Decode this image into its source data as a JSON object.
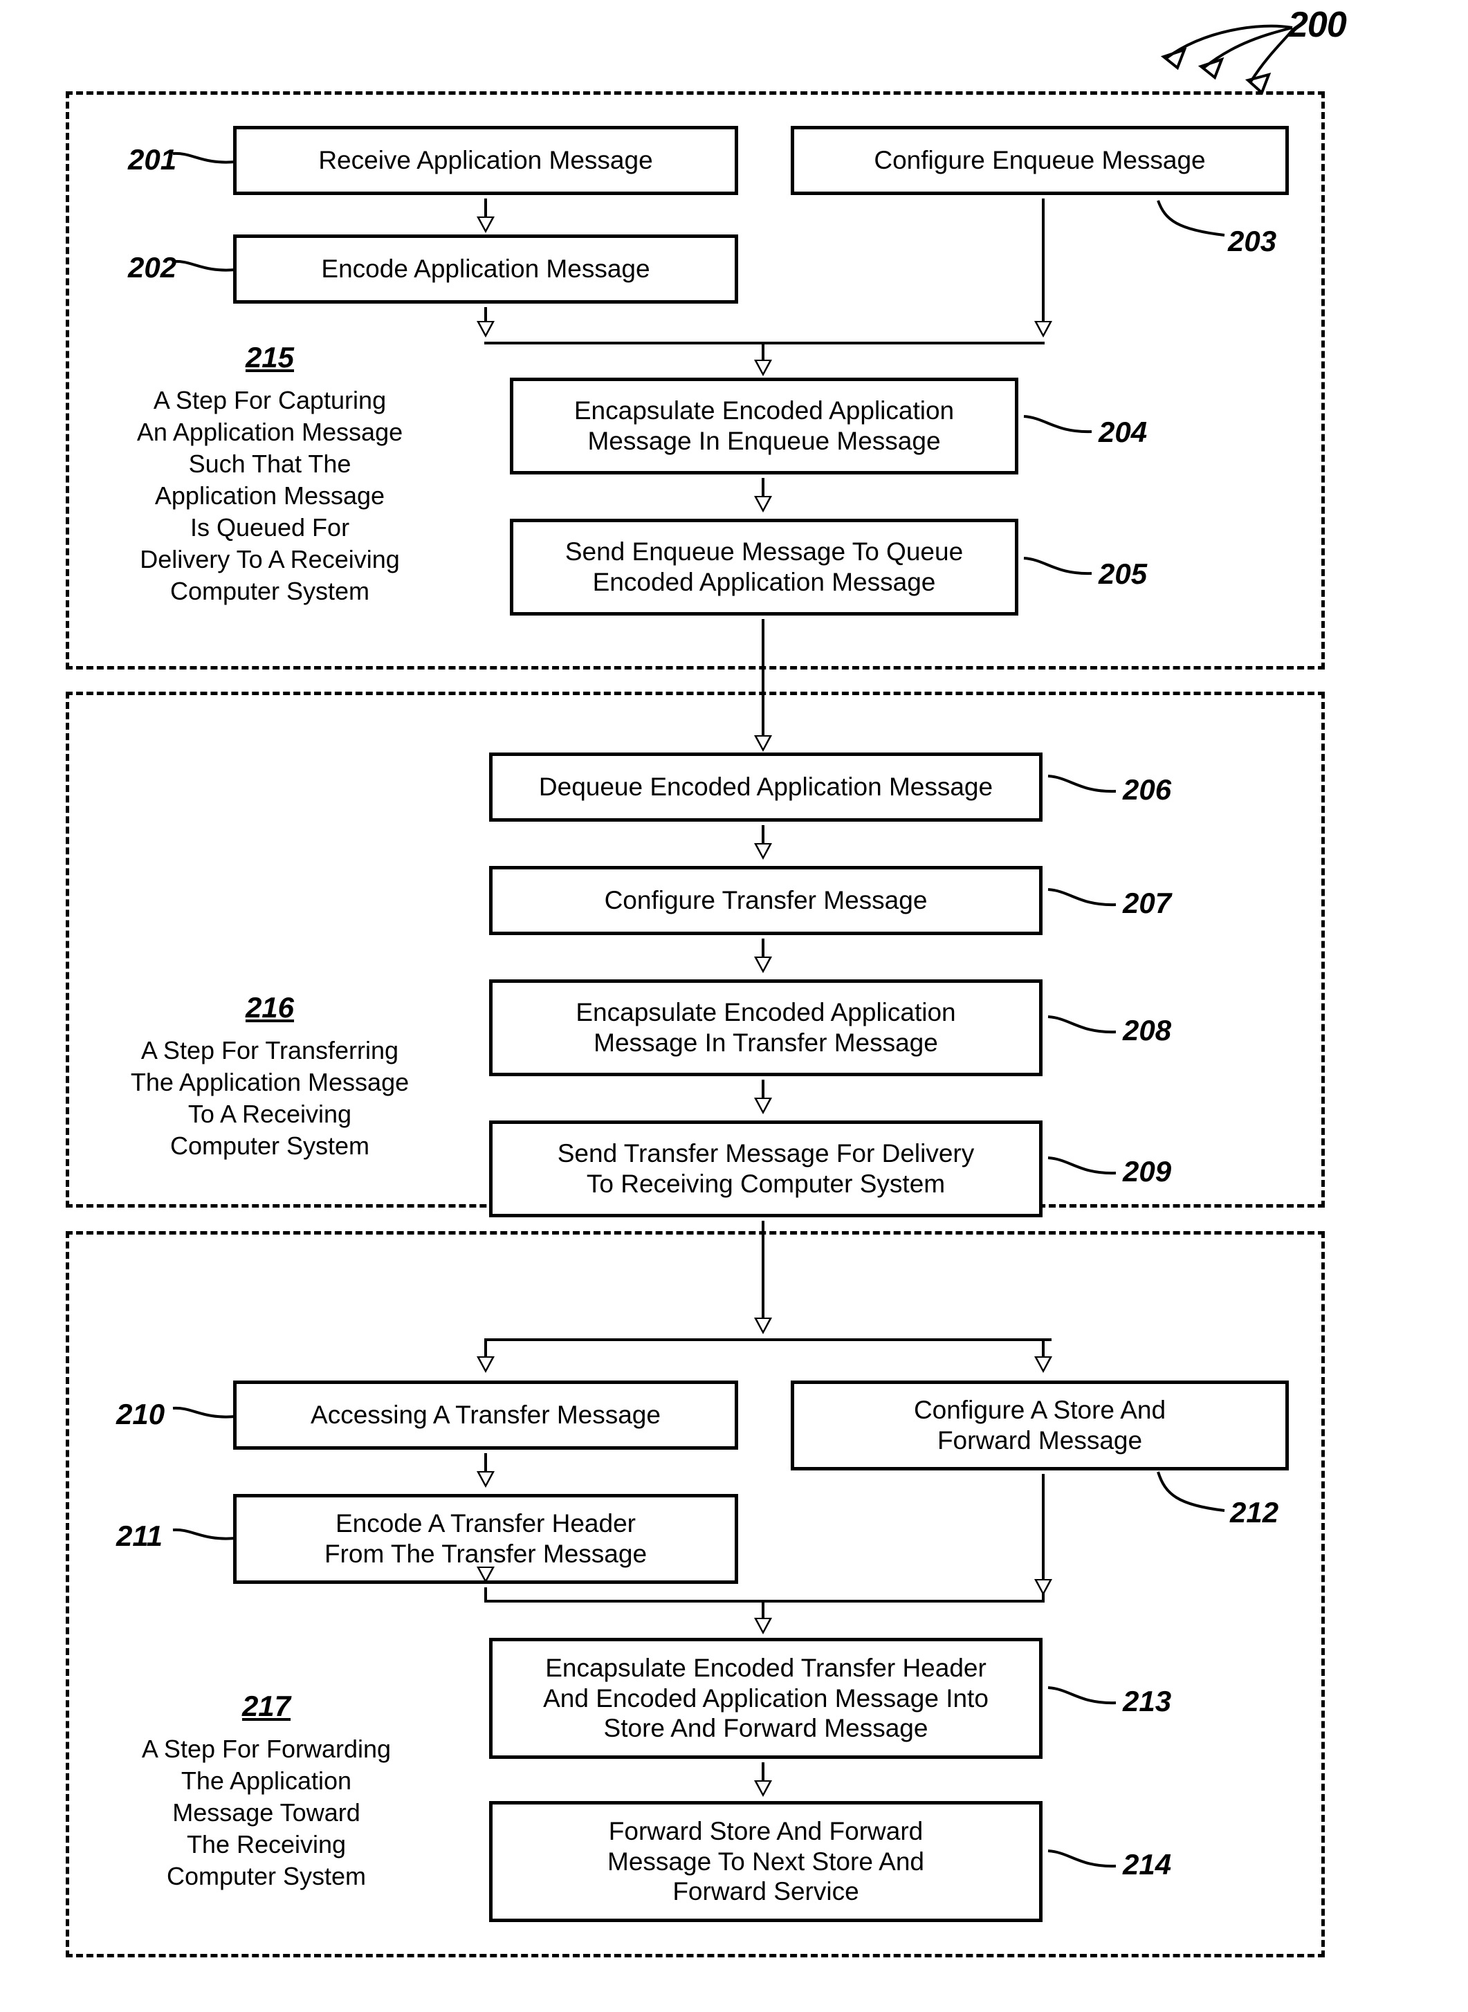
{
  "figure": {
    "number": "200",
    "pointer_icon": "curved-arrows-icon"
  },
  "sections": [
    {
      "id": "section-215",
      "step_number": "215",
      "step_text": "A Step For Capturing An Application Message Such That The Application Message Is Queued For Delivery To A Receiving Computer System",
      "step_lines": [
        "A Step For Capturing",
        "An Application Message",
        "Such That The",
        "Application Message",
        "Is Queued For",
        "Delivery To A Receiving",
        "Computer System"
      ],
      "boxes": [
        {
          "ref": "201",
          "lines": [
            "Receive Application Message"
          ]
        },
        {
          "ref": "202",
          "lines": [
            "Encode Application Message"
          ]
        },
        {
          "ref": "203",
          "lines": [
            "Configure Enqueue Message"
          ]
        },
        {
          "ref": "204",
          "lines": [
            "Encapsulate Encoded Application",
            "Message In Enqueue Message"
          ]
        },
        {
          "ref": "205",
          "lines": [
            "Send Enqueue Message To Queue",
            "Encoded Application Message"
          ]
        }
      ]
    },
    {
      "id": "section-216",
      "step_number": "216",
      "step_text": "A Step For Transferring The Application Message To A Receiving Computer System",
      "step_lines": [
        "A Step For Transferring",
        "The Application Message",
        "To A Receiving",
        "Computer System"
      ],
      "boxes": [
        {
          "ref": "206",
          "lines": [
            "Dequeue Encoded Application Message"
          ]
        },
        {
          "ref": "207",
          "lines": [
            "Configure Transfer Message"
          ]
        },
        {
          "ref": "208",
          "lines": [
            "Encapsulate Encoded Application",
            "Message In Transfer Message"
          ]
        },
        {
          "ref": "209",
          "lines": [
            "Send Transfer Message For Delivery",
            "To Receiving Computer System"
          ]
        }
      ]
    },
    {
      "id": "section-217",
      "step_number": "217",
      "step_text": "A Step For Forwarding The Application Message Toward The Receiving Computer System",
      "step_lines": [
        "A Step For Forwarding",
        "The Application",
        "Message Toward",
        "The Receiving",
        "Computer System"
      ],
      "boxes": [
        {
          "ref": "210",
          "lines": [
            "Accessing A Transfer Message"
          ]
        },
        {
          "ref": "211",
          "lines": [
            "Encode A Transfer Header",
            "From The Transfer Message"
          ]
        },
        {
          "ref": "212",
          "lines": [
            "Configure A Store And",
            "Forward Message"
          ]
        },
        {
          "ref": "213",
          "lines": [
            "Encapsulate Encoded Transfer Header",
            "And Encoded Application Message Into",
            "Store And Forward Message"
          ]
        },
        {
          "ref": "214",
          "lines": [
            "Forward Store And Forward",
            "Message To Next Store And",
            "Forward Service"
          ]
        }
      ]
    }
  ],
  "colors": {
    "ink": "#000000",
    "paper": "#ffffff"
  }
}
